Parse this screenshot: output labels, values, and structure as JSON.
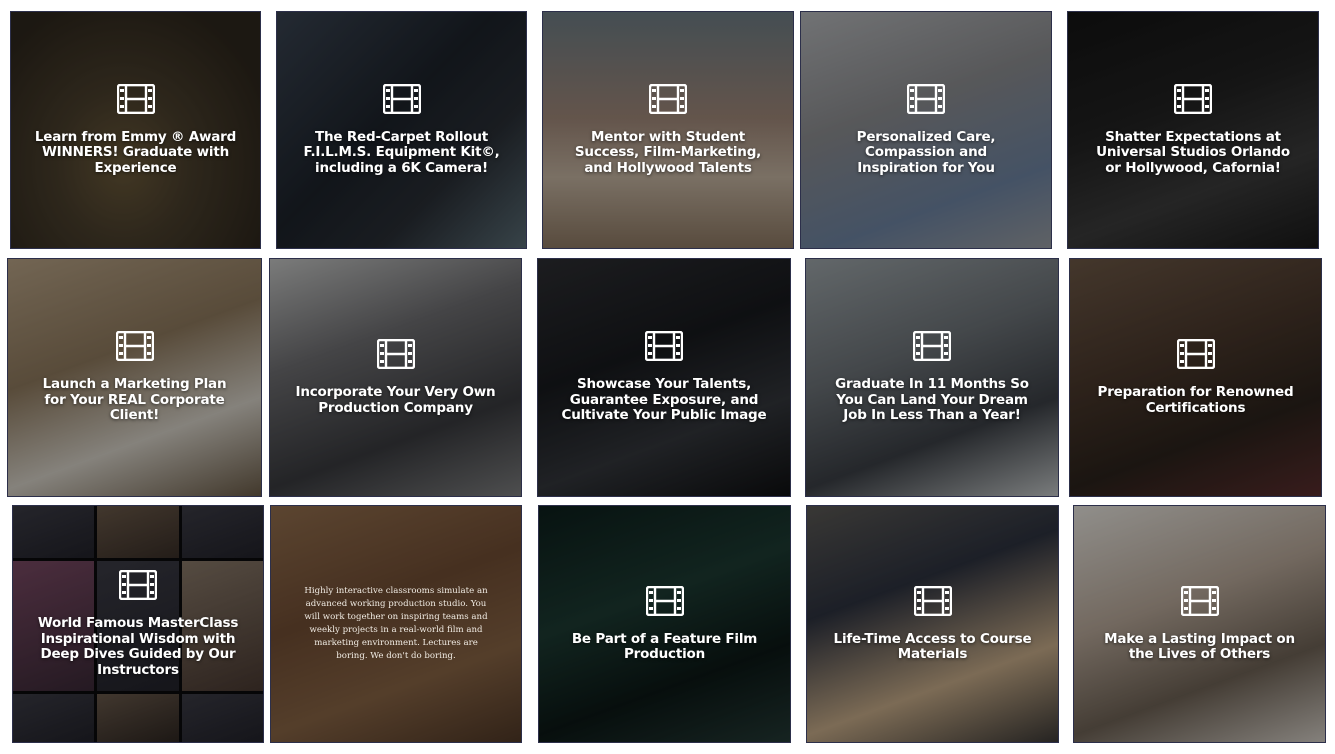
{
  "tiles": [
    {
      "title": "Learn from Emmy ® Award\nWINNERS! Graduate with\nExperience"
    },
    {
      "title": "The Red-Carpet Rollout\nF.I.L.M.S. Equipment Kit©,\nincluding a 6K Camera!"
    },
    {
      "title": "Mentor with Student\nSuccess, Film-Marketing,\nand Hollywood Talents"
    },
    {
      "title": "Personalized Care,\nCompassion and\nInspiration for You"
    },
    {
      "title": "Shatter Expectations at\nUniversal Studios Orlando\nor Hollywood, Cafornia!"
    },
    {
      "title": "Launch a Marketing Plan\nfor Your REAL Corporate\nClient!"
    },
    {
      "title": "Incorporate Your Very Own\nProduction Company"
    },
    {
      "title": "Showcase Your Talents,\nGuarantee Exposure, and\nCultivate Your Public Image"
    },
    {
      "title": "Graduate In 11 Months So\nYou Can Land Your Dream\nJob In Less Than a Year!"
    },
    {
      "title": "Preparation for Renowned\nCertifications"
    },
    {
      "title": "World Famous MasterClass\nInspirational Wisdom with\nDeep Dives Guided by Our\nInstructors"
    },
    {
      "body": "Highly interactive classrooms simulate an advanced working production studio. You will work together on inspiring teams and weekly projects in a real-world film and marketing environment. Lectures are boring. We don't do boring."
    },
    {
      "title": "Be Part of a Feature Film\nProduction"
    },
    {
      "title": "Life-Time Access to Course\nMaterials"
    },
    {
      "title": "Make a Lasting Impact on\nthe Lives of Others"
    }
  ],
  "icon": "film-strip-icon",
  "colors": {
    "text": "#ffffff",
    "border": "#2c2f4a",
    "background": "#ffffff"
  }
}
